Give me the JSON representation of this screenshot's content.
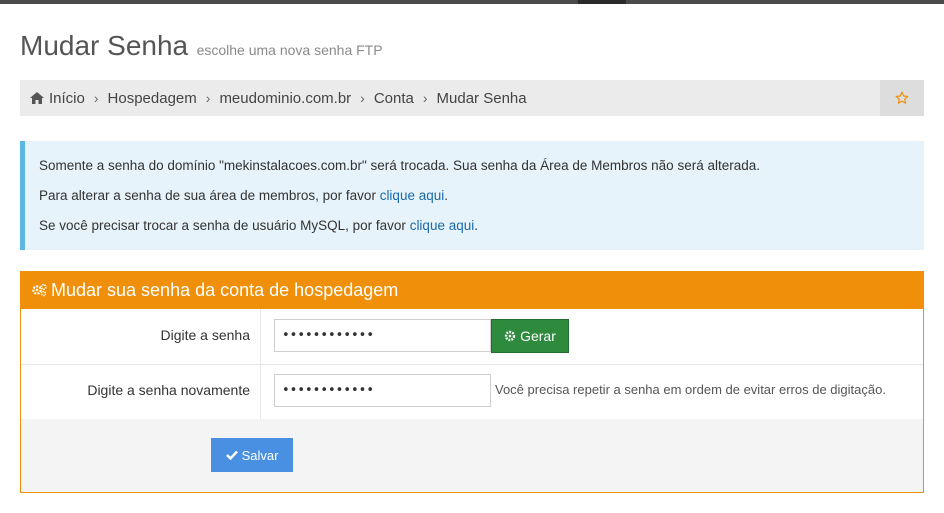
{
  "header": {
    "title": "Mudar Senha",
    "subtitle": "escolhe uma nova senha FTP"
  },
  "breadcrumb": {
    "items": [
      "Início",
      "Hospedagem",
      "meudominio.com.br",
      "Conta",
      "Mudar Senha"
    ],
    "home_icon": "home-icon",
    "favorite_icon": "star-outline-icon"
  },
  "info": {
    "line1": "Somente a senha do domínio \"mekinstalacoes.com.br\" será trocada. Sua senha da Área de Membros não será alterada.",
    "line2_prefix": "Para alterar a senha de sua área de membros, por favor ",
    "line2_link": "clique aqui",
    "line2_suffix": ".",
    "line3_prefix": "Se você precisar trocar a senha de usuário MySQL, por favor ",
    "line3_link": "clique aqui",
    "line3_suffix": "."
  },
  "panel": {
    "title": "Mudar sua senha da conta de hospedagem",
    "icon": "cogs-icon",
    "password_label": "Digite a senha",
    "password_value": "••••••••••••",
    "generate_label": "Gerar",
    "confirm_label": "Digite a senha novamente",
    "confirm_value": "••••••••••••",
    "confirm_help": "Você precisa repetir a senha em ordem de evitar erros de digitação.",
    "save_label": "Salvar"
  },
  "colors": {
    "accent_orange": "#f0900a",
    "info_border": "#5bb8e6",
    "generate_green": "#2e8b3e",
    "save_blue": "#4a90e2"
  }
}
